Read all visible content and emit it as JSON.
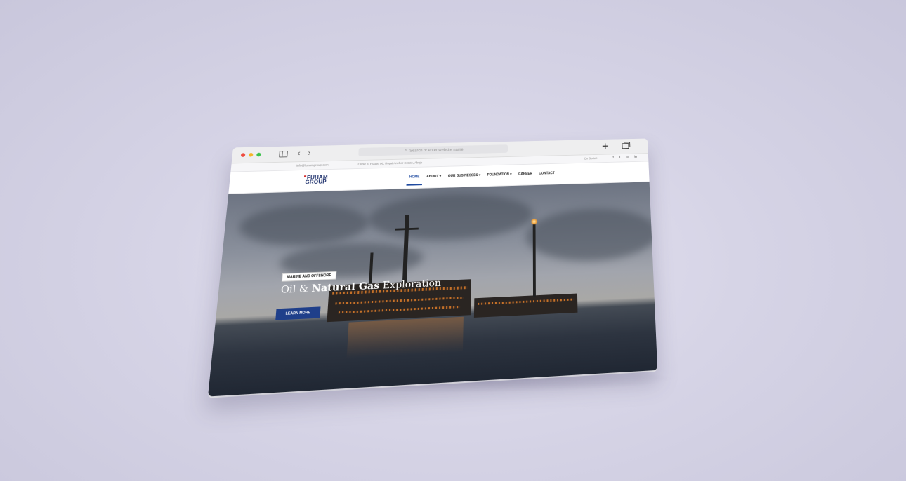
{
  "browser": {
    "address_placeholder": "Search or enter website name"
  },
  "topbar": {
    "email": "info@fuhamgroup.com",
    "address": "Close 8, House 96, Royal Anchor Estate, Abuja",
    "social_label": "On Social:",
    "social_icons": [
      "facebook-icon",
      "twitter-icon",
      "instagram-icon",
      "linkedin-icon"
    ]
  },
  "logo": {
    "line1": "FUHAM",
    "line2": "GROUP"
  },
  "nav": {
    "home": "HOME",
    "about": "ABOUT",
    "businesses": "OUR BUSINESSES",
    "foundation": "FOUNDATION",
    "career": "CAREER",
    "contact": "CONTACT"
  },
  "hero": {
    "badge": "MARINE AND OFFSHORE",
    "headline_light_1": "Oil &",
    "headline_bold": "Natural Gas",
    "headline_light_2": "Exploration",
    "cta": "LEARN MORE"
  },
  "colors": {
    "brand_blue": "#1c2f6b",
    "cta_blue": "#1f3f8a",
    "logo_accent": "#d62d2d",
    "background": "#d6d4e6"
  }
}
